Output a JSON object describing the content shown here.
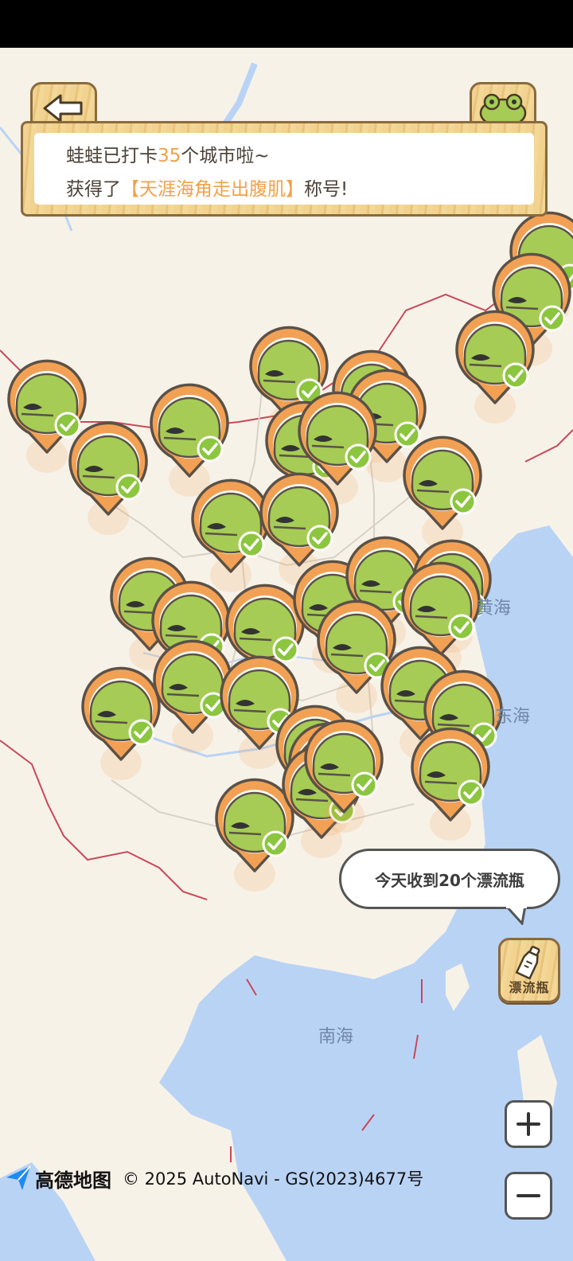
{
  "header": {
    "back_label": "返回",
    "mine_label": "我的"
  },
  "message": {
    "line1_prefix": "蛙蛙已打卡",
    "city_count": "35",
    "line1_suffix": "个城市啦~",
    "line2_prefix": "获得了",
    "title": "【天涯海角走出腹肌】",
    "line2_suffix": "称号!"
  },
  "map_labels": {
    "yellow_sea": "黄海",
    "east_sea": "东海",
    "south_sea": "南海"
  },
  "bubble": {
    "text": "今天收到20个漂流瓶"
  },
  "drift_bottle": {
    "label": "漂流瓶"
  },
  "zoom": {
    "in_icon": "plus-icon",
    "out_icon": "minus-icon"
  },
  "footer": {
    "brand": "高德地图",
    "copyright": "© 2025 AutoNavi - GS(2023)4677号"
  },
  "colors": {
    "pin_orange": "#f2a154",
    "pin_outline": "#5b5147",
    "frog_green": "#a6cc55",
    "check_green": "#8cc63f",
    "sea": "#b9d3f5",
    "land": "#f7f2e8",
    "border_red": "#c9485a"
  },
  "pins_visited": 35
}
